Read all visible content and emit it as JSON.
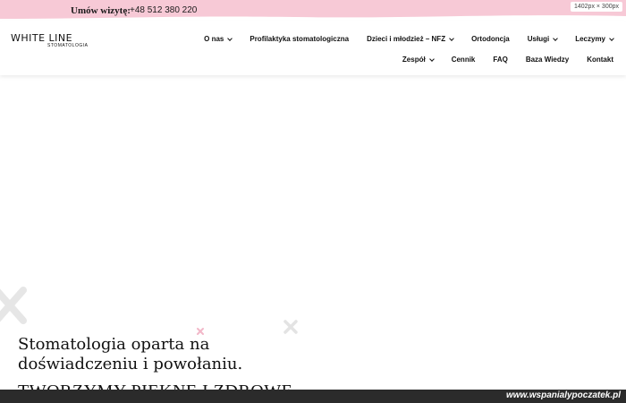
{
  "topbar": {
    "label": "Umów wizytę:",
    "phone": "+48 512 380 220",
    "dimensions": "1402px × 300px",
    "color": "#f7c9d6"
  },
  "logo": {
    "main": "WHITE LINE",
    "sub": "STOMATOLOGIA"
  },
  "nav": {
    "row1": [
      {
        "label": "O nas",
        "dropdown": true
      },
      {
        "label": "Profilaktyka stomatologiczna",
        "dropdown": false
      },
      {
        "label": "Dzieci i młodzież – NFZ",
        "dropdown": true
      },
      {
        "label": "Ortodoncja",
        "dropdown": false
      },
      {
        "label": "Usługi",
        "dropdown": true
      },
      {
        "label": "Leczymy",
        "dropdown": true
      }
    ],
    "row2": [
      {
        "label": "Zespół",
        "dropdown": true
      },
      {
        "label": "Cennik",
        "dropdown": false
      },
      {
        "label": "FAQ",
        "dropdown": false
      },
      {
        "label": "Baza Wiedzy",
        "dropdown": false
      },
      {
        "label": "Kontakt",
        "dropdown": false
      }
    ]
  },
  "hero": {
    "title_line1": "Stomatologia oparta na",
    "title_line2": "doświadczeniu i powołaniu.",
    "subtitle": "TWORZYMY PIĘKNE I ZDROWE"
  },
  "watermark": {
    "text": "www.wspanialypoczatek.pl"
  }
}
